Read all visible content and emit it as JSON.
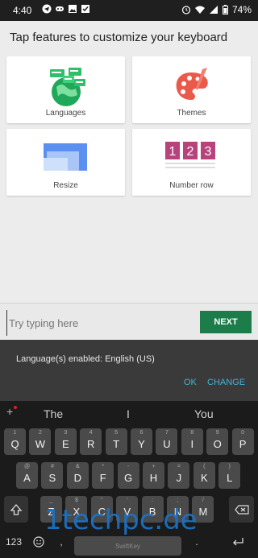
{
  "status_bar": {
    "time": "4:40",
    "battery": "74%"
  },
  "header": {
    "title": "Tap features to customize your keyboard"
  },
  "features": [
    {
      "label": "Languages",
      "icon": "globe-icon"
    },
    {
      "label": "Themes",
      "icon": "palette-icon"
    },
    {
      "label": "Resize",
      "icon": "resize-icon"
    },
    {
      "label": "Number row",
      "icon": "number-row-icon",
      "digits": [
        "1",
        "2",
        "3"
      ]
    }
  ],
  "typing": {
    "placeholder": "Try typing here",
    "next_label": "NEXT"
  },
  "snackbar": {
    "message": "Language(s) enabled: English (US)",
    "ok_label": "OK",
    "change_label": "CHANGE"
  },
  "keyboard": {
    "predictions": [
      "The",
      "I",
      "You"
    ],
    "row1": [
      {
        "key": "Q",
        "sub": "1"
      },
      {
        "key": "W",
        "sub": "2"
      },
      {
        "key": "E",
        "sub": "3"
      },
      {
        "key": "R",
        "sub": "4"
      },
      {
        "key": "T",
        "sub": "5"
      },
      {
        "key": "Y",
        "sub": "6"
      },
      {
        "key": "U",
        "sub": "7"
      },
      {
        "key": "I",
        "sub": "8"
      },
      {
        "key": "O",
        "sub": "9"
      },
      {
        "key": "P",
        "sub": "0"
      }
    ],
    "row2": [
      {
        "key": "A",
        "sub": "@"
      },
      {
        "key": "S",
        "sub": "#"
      },
      {
        "key": "D",
        "sub": "&"
      },
      {
        "key": "F",
        "sub": "*"
      },
      {
        "key": "G",
        "sub": "-"
      },
      {
        "key": "H",
        "sub": "+"
      },
      {
        "key": "J",
        "sub": "="
      },
      {
        "key": "K",
        "sub": "("
      },
      {
        "key": "L",
        "sub": ")"
      }
    ],
    "row3": [
      {
        "key": "Z",
        "sub": "_"
      },
      {
        "key": "X",
        "sub": "$"
      },
      {
        "key": "C",
        "sub": "\""
      },
      {
        "key": "V",
        "sub": "'"
      },
      {
        "key": "B",
        "sub": ":"
      },
      {
        "key": "N",
        "sub": ";"
      },
      {
        "key": "M",
        "sub": "/"
      }
    ],
    "sym_label": "123",
    "space_label": "SwiftKey",
    "comma": ",",
    "period": "."
  },
  "watermark": "1techpc.de",
  "colors": {
    "accent_green": "#1d7d4a",
    "snackbar_action": "#3fb6d6",
    "watermark": "#1a73c8"
  }
}
